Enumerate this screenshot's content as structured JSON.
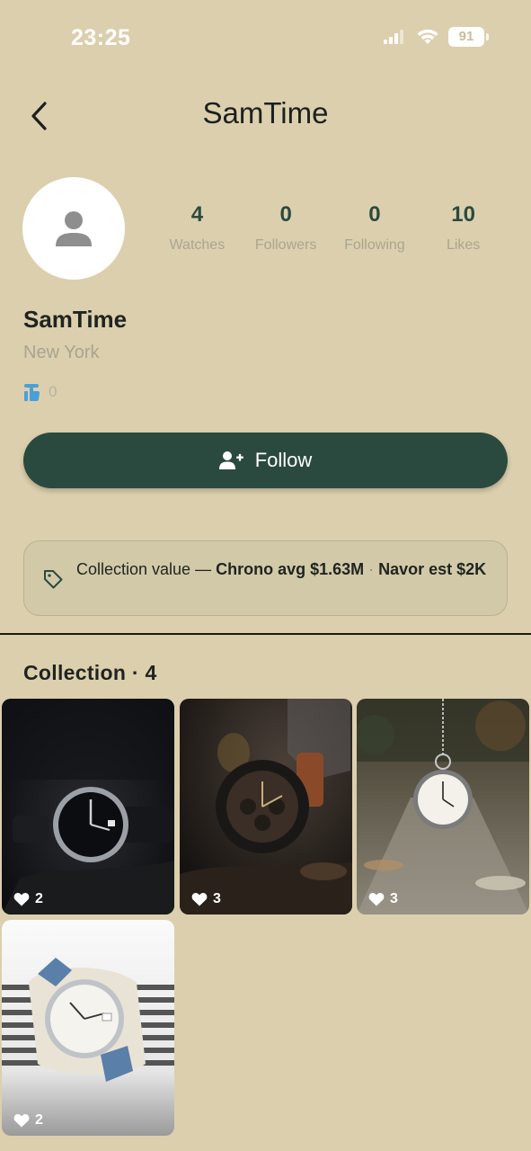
{
  "status": {
    "time": "23:25",
    "battery": "91"
  },
  "header": {
    "title": "SamTime"
  },
  "stats": [
    {
      "value": "4",
      "label": "Watches"
    },
    {
      "value": "0",
      "label": "Followers"
    },
    {
      "value": "0",
      "label": "Following"
    },
    {
      "value": "10",
      "label": "Likes"
    }
  ],
  "profile": {
    "name": "SamTime",
    "location": "New York",
    "thumbs_count": "0"
  },
  "actions": {
    "follow_label": "Follow"
  },
  "value_card": {
    "prefix": "Collection value — ",
    "chrono": "Chrono avg $1.63M",
    "separator": " · ",
    "navor": "Navor est $2K"
  },
  "collection": {
    "title": "Collection · 4",
    "items": [
      {
        "likes": "2",
        "icon": "heart-icon"
      },
      {
        "likes": "3",
        "icon": "heart-icon"
      },
      {
        "likes": "3",
        "icon": "heart-icon"
      },
      {
        "likes": "2",
        "icon": "heart-icon"
      }
    ]
  },
  "colors": {
    "background": "#dccfae",
    "accent": "#2b4a3f",
    "card": "#d2c9a8"
  }
}
